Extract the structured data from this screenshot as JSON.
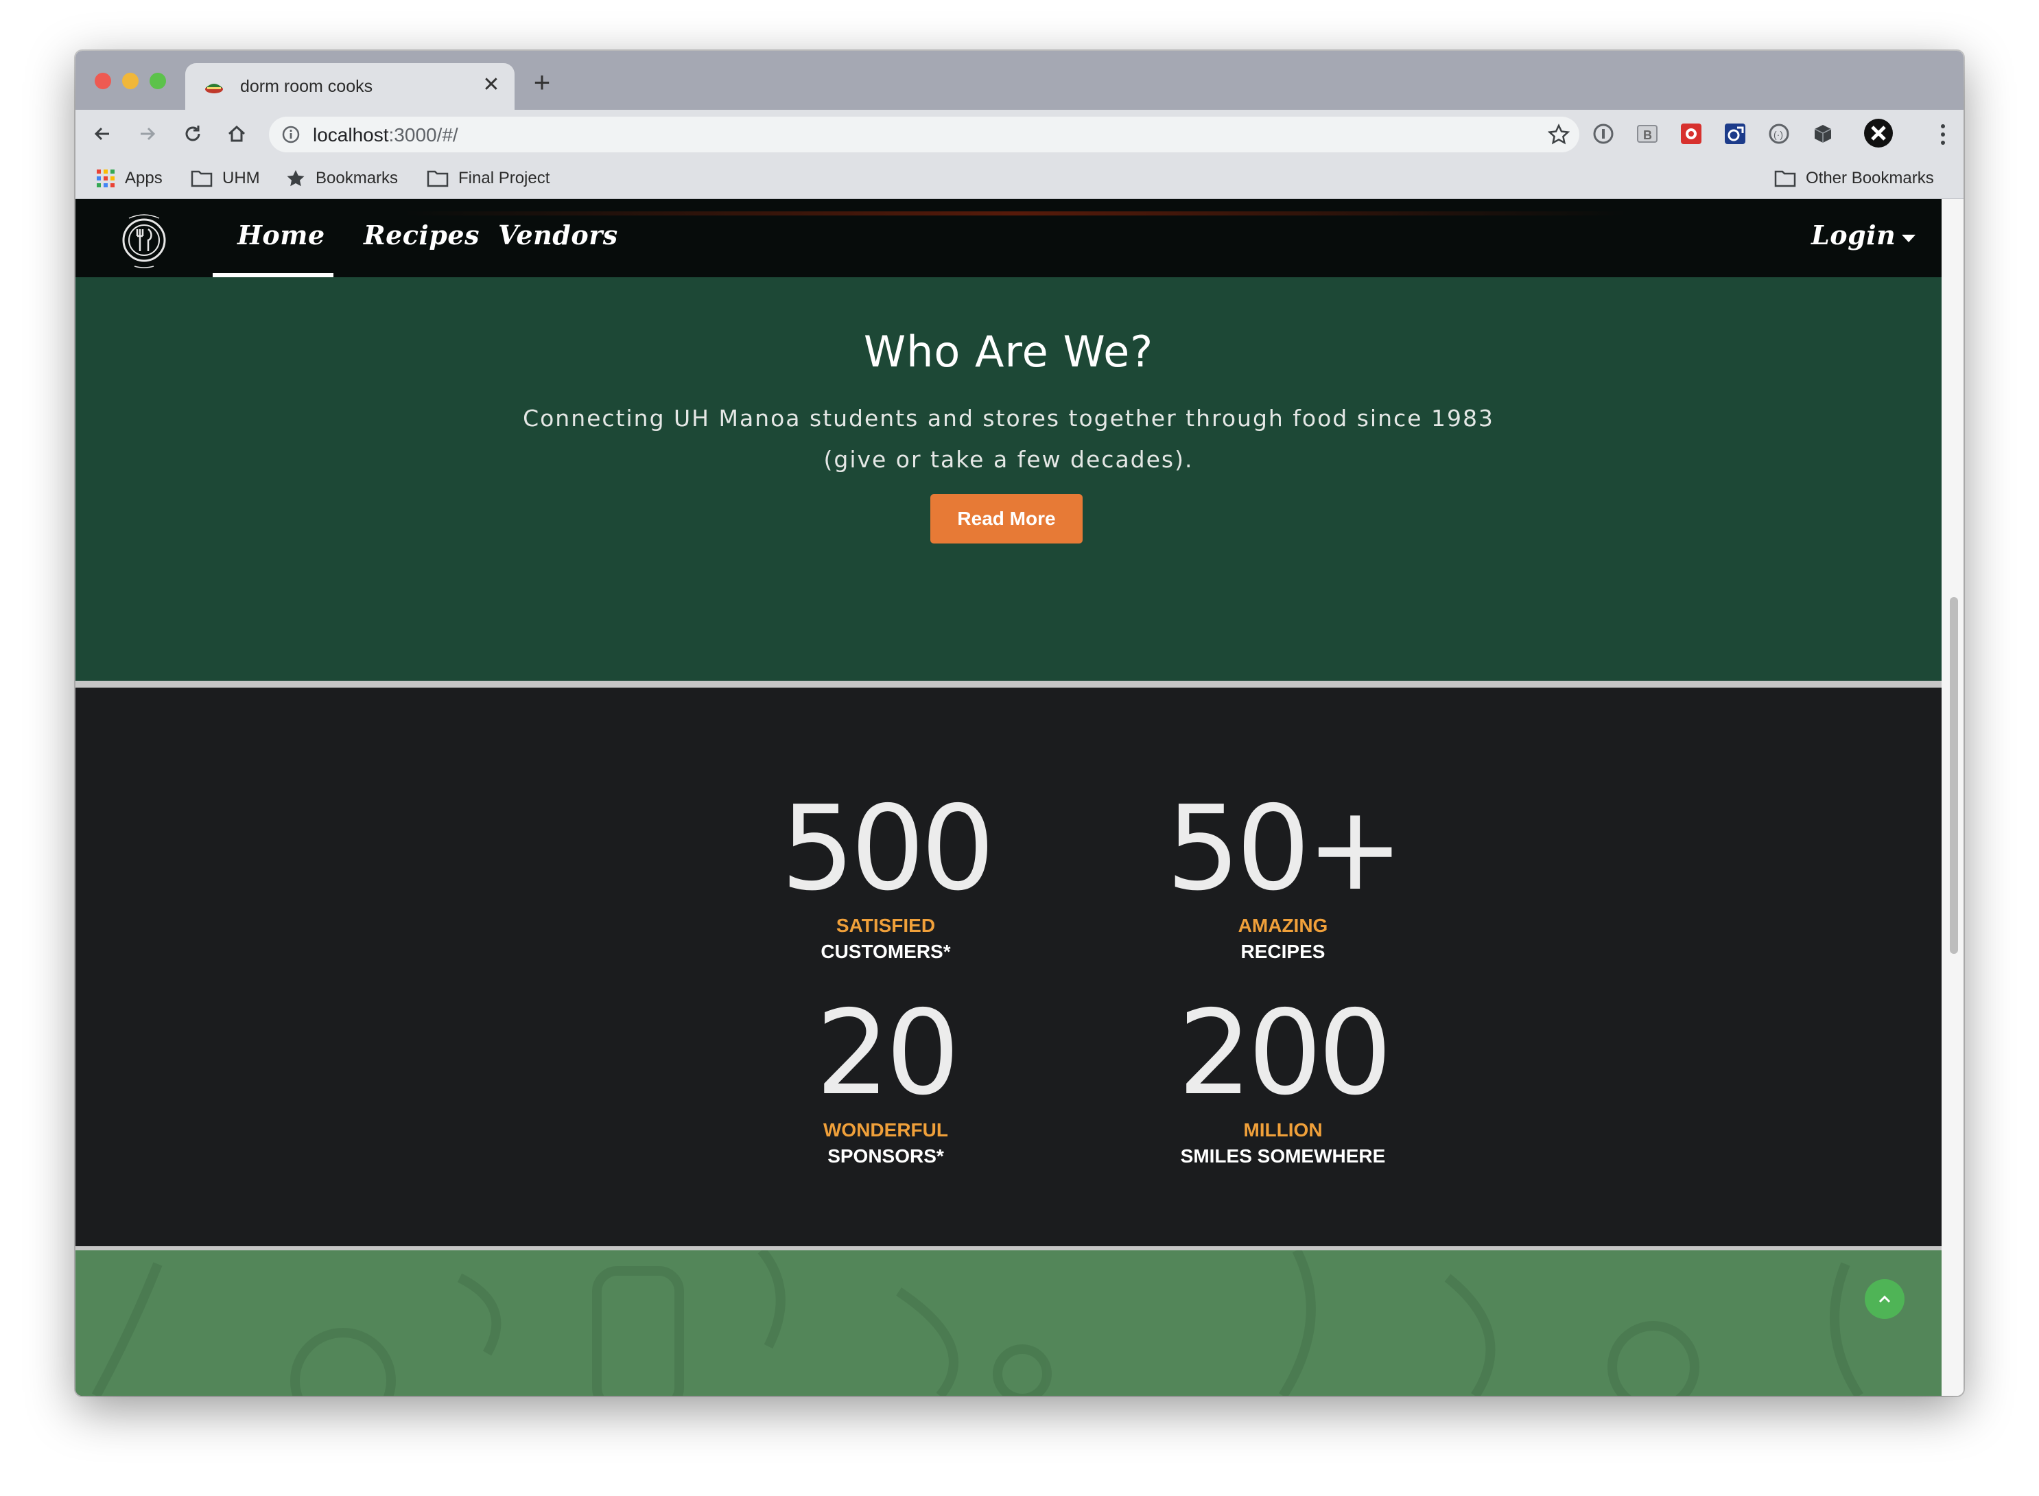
{
  "browser": {
    "tab_title": "dorm room cooks",
    "url_host": "localhost",
    "url_path": ":3000/#/",
    "bookmarks": [
      "Apps",
      "UHM",
      "Bookmarks",
      "Final Project"
    ],
    "other_bookmarks": "Other Bookmarks"
  },
  "site": {
    "nav": {
      "home": "Home",
      "recipes": "Recipes",
      "vendors": "Vendors",
      "login": "Login"
    },
    "hero": {
      "title": "Who Are We?",
      "subtitle_line1": "Connecting UH Manoa students and stores together through food since 1983",
      "subtitle_line2": "(give or take a few decades).",
      "button": "Read More"
    },
    "stats": [
      {
        "number": "500",
        "line1": "SATISFIED",
        "line2": "CUSTOMERS*"
      },
      {
        "number": "50+",
        "line1": "AMAZING",
        "line2": "RECIPES"
      },
      {
        "number": "20",
        "line1": "WONDERFUL",
        "line2": "SPONSORS*"
      },
      {
        "number": "200",
        "line1": "MILLION",
        "line2": "SMILES SOMEWHERE"
      }
    ]
  },
  "colors": {
    "hero_bg": "#1d4836",
    "stats_bg": "#1b1c1e",
    "accent_orange": "#e77a36",
    "stat_label": "#f0a03a",
    "footer_green": "#538659"
  },
  "icons": [
    "back-icon",
    "forward-icon",
    "reload-icon",
    "home-icon",
    "info-icon",
    "star-icon",
    "folder-icon",
    "apps-grid-icon",
    "chevron-up-icon",
    "close-icon",
    "plus-icon"
  ]
}
